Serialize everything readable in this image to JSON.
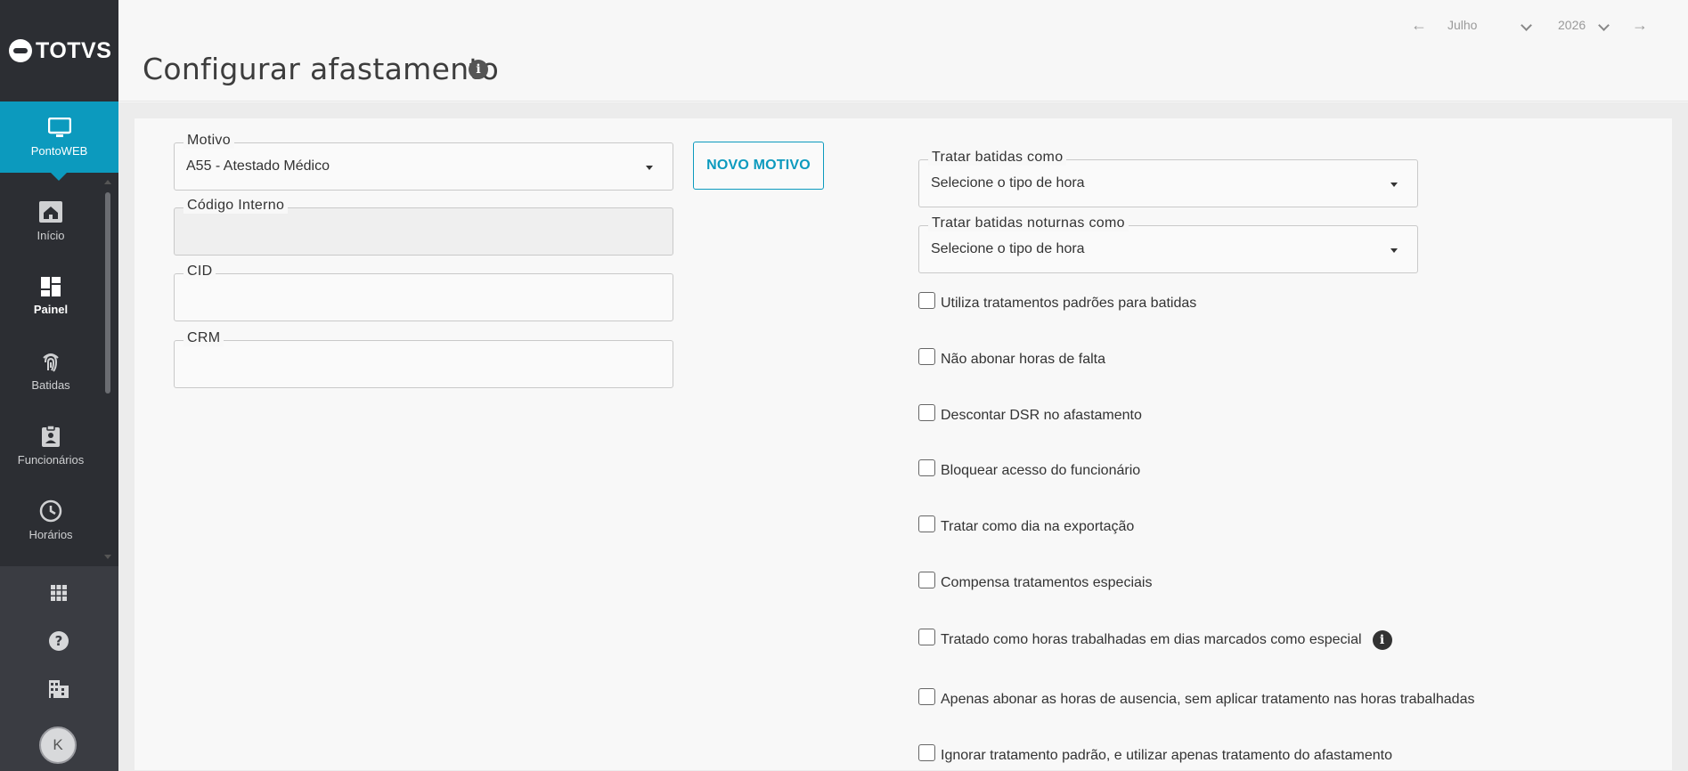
{
  "brand": {
    "logo_text": "TOTVS",
    "accent": "#0c9abe"
  },
  "sidebar": {
    "active": {
      "label": "PontoWEB",
      "icon": "monitor-icon"
    },
    "items": [
      {
        "label": "Início",
        "icon": "home-icon"
      },
      {
        "label": "Painel",
        "icon": "dashboard-icon"
      },
      {
        "label": "Batidas",
        "icon": "fingerprint-icon"
      },
      {
        "label": "Funcionários",
        "icon": "badge-icon"
      },
      {
        "label": "Horários",
        "icon": "clock-icon"
      }
    ],
    "bottom": [
      {
        "icon": "apps-grid-icon"
      },
      {
        "icon": "help-icon"
      },
      {
        "icon": "building-icon"
      }
    ],
    "avatar_initial": "K"
  },
  "header": {
    "title": "Configurar afastamento",
    "period": {
      "month": "Julho",
      "year": "2026"
    }
  },
  "form": {
    "motivo": {
      "label": "Motivo",
      "value": "A55 - Atestado Médico"
    },
    "codigo_interno": {
      "label": "Código Interno",
      "value": ""
    },
    "cid": {
      "label": "CID",
      "value": ""
    },
    "crm": {
      "label": "CRM",
      "value": ""
    },
    "novo_motivo_label": "NOVO MOTIVO",
    "tratar_batidas": {
      "label": "Tratar batidas como",
      "value": "Selecione o tipo de hora"
    },
    "tratar_noturnas": {
      "label": "Tratar batidas noturnas como",
      "value": "Selecione o tipo de hora"
    },
    "checks": [
      "Utiliza tratamentos padrões para batidas",
      "Não abonar horas de falta",
      "Descontar DSR no afastamento",
      "Bloquear acesso do funcionário",
      "Tratar como dia na exportação",
      "Compensa tratamentos especiais",
      "Tratado como horas trabalhadas em dias marcados como especial",
      "Apenas abonar as horas de ausencia, sem aplicar tratamento nas horas trabalhadas",
      "Ignorar tratamento padrão, e utilizar apenas tratamento do afastamento"
    ]
  }
}
